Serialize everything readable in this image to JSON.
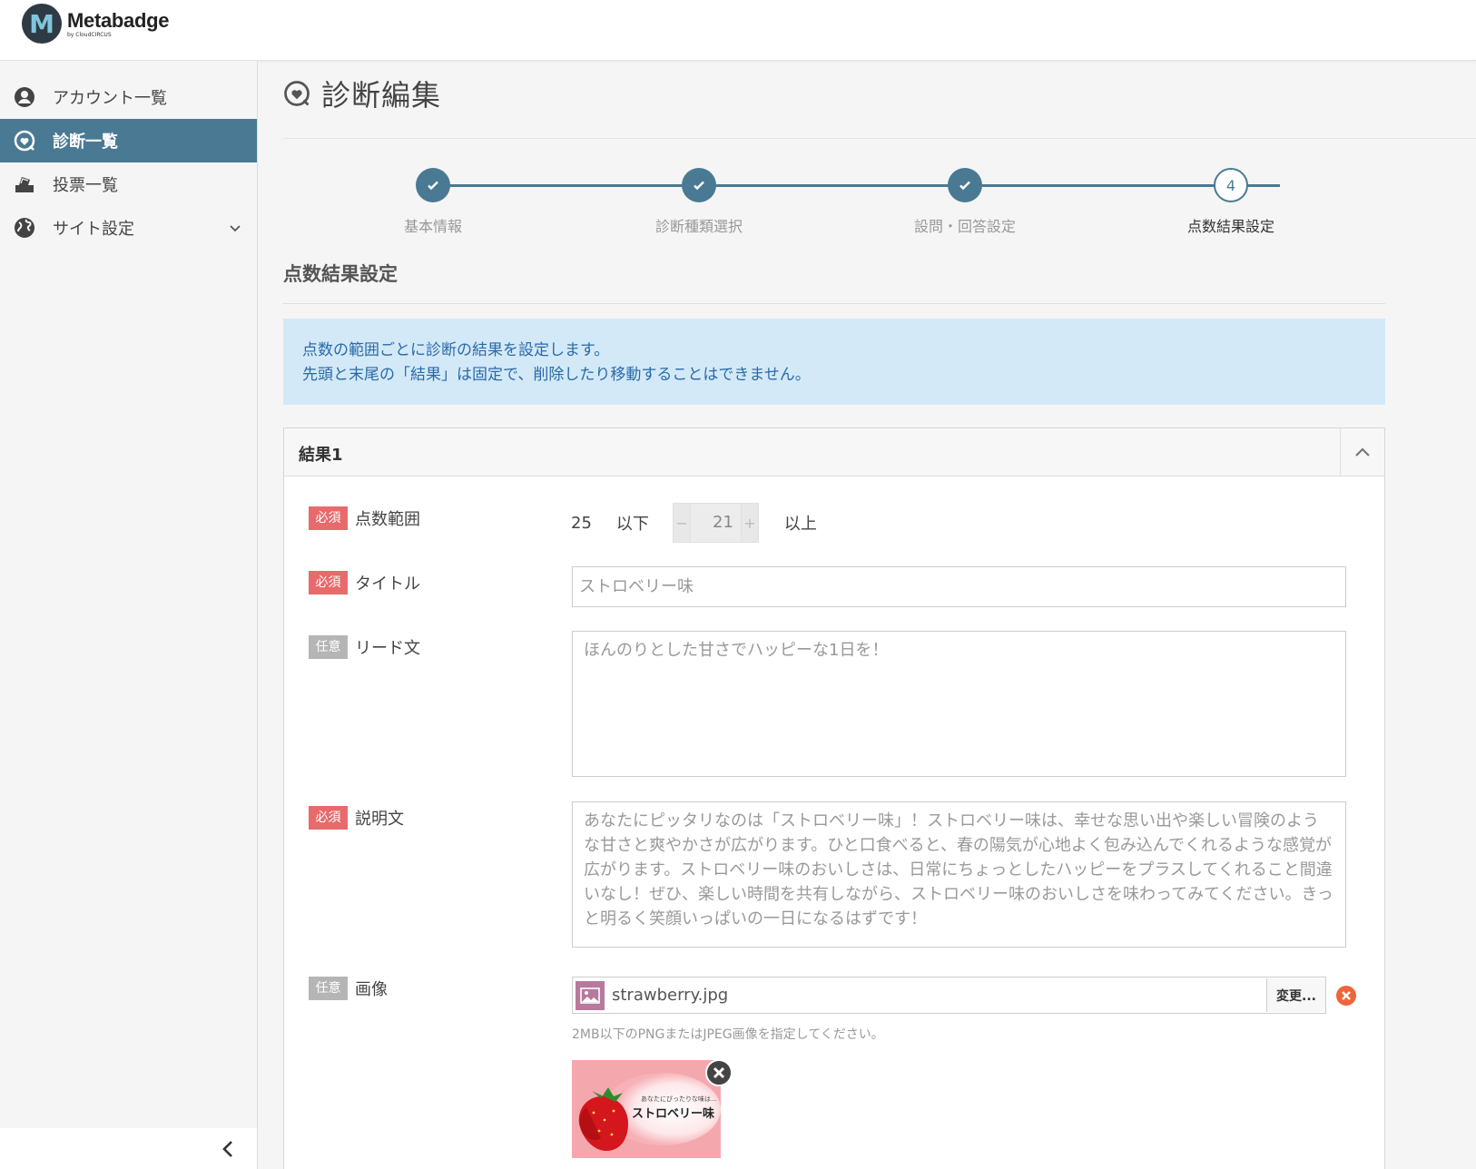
{
  "app": {
    "name": "Metabadge",
    "by": "by CloudCIRCUS"
  },
  "sidebar": {
    "items": [
      {
        "label": "アカウント一覧",
        "icon": "user-circle-icon"
      },
      {
        "label": "診断一覧",
        "icon": "diagnosis-icon"
      },
      {
        "label": "投票一覧",
        "icon": "vote-box-icon"
      },
      {
        "label": "サイト設定",
        "icon": "globe-icon"
      }
    ]
  },
  "page": {
    "title": "診断編集"
  },
  "stepper": {
    "steps": [
      {
        "label": "基本情報",
        "state": "done"
      },
      {
        "label": "診断種類選択",
        "state": "done"
      },
      {
        "label": "設問・回答設定",
        "state": "done"
      },
      {
        "label": "点数結果設定",
        "state": "current",
        "number": "4"
      }
    ]
  },
  "section": {
    "title": "点数結果設定"
  },
  "info": {
    "line1": "点数の範囲ごとに診断の結果を設定します。",
    "line2": "先頭と末尾の「結果」は固定で、削除したり移動することはできません。"
  },
  "result": {
    "title": "結果1",
    "badges": {
      "required": "必須",
      "optional": "任意"
    },
    "score": {
      "label": "点数範囲",
      "max": "25",
      "max_suffix": "以下",
      "min": "21",
      "min_suffix": "以上",
      "minus": "−",
      "plus": "+"
    },
    "title_field": {
      "label": "タイトル",
      "value": "ストロベリー味"
    },
    "lead": {
      "label": "リード文",
      "value": "ほんのりとした甘さでハッピーな1日を！"
    },
    "description": {
      "label": "説明文",
      "value": "あなたにピッタリなのは「ストロベリー味」！ストロベリー味は、幸せな思い出や楽しい冒険のような甘さと爽やかさが広がります。ひと口食べると、春の陽気が心地よく包み込んでくれるような感覚が広がります。ストロベリー味のおいしさは、日常にちょっとしたハッピーをプラスしてくれること間違いなし！ぜひ、楽しい時間を共有しながら、ストロベリー味のおいしさを味わってみてください。きっと明るく笑顔いっぱいの一日になるはずです！"
    },
    "image": {
      "label": "画像",
      "file_name": "strawberry.jpg",
      "change_label": "変更...",
      "hint": "2MB以下のPNGまたはJPEG画像を指定してください。",
      "thumb_caption_small": "あなたにぴったりな味は…",
      "thumb_caption": "ストロベリー味"
    }
  },
  "colors": {
    "accent": "#4a7a93",
    "required": "#e86a6a",
    "optional": "#b5b5b5",
    "info_bg": "#d3e9f8",
    "info_text": "#2a6aa8"
  }
}
